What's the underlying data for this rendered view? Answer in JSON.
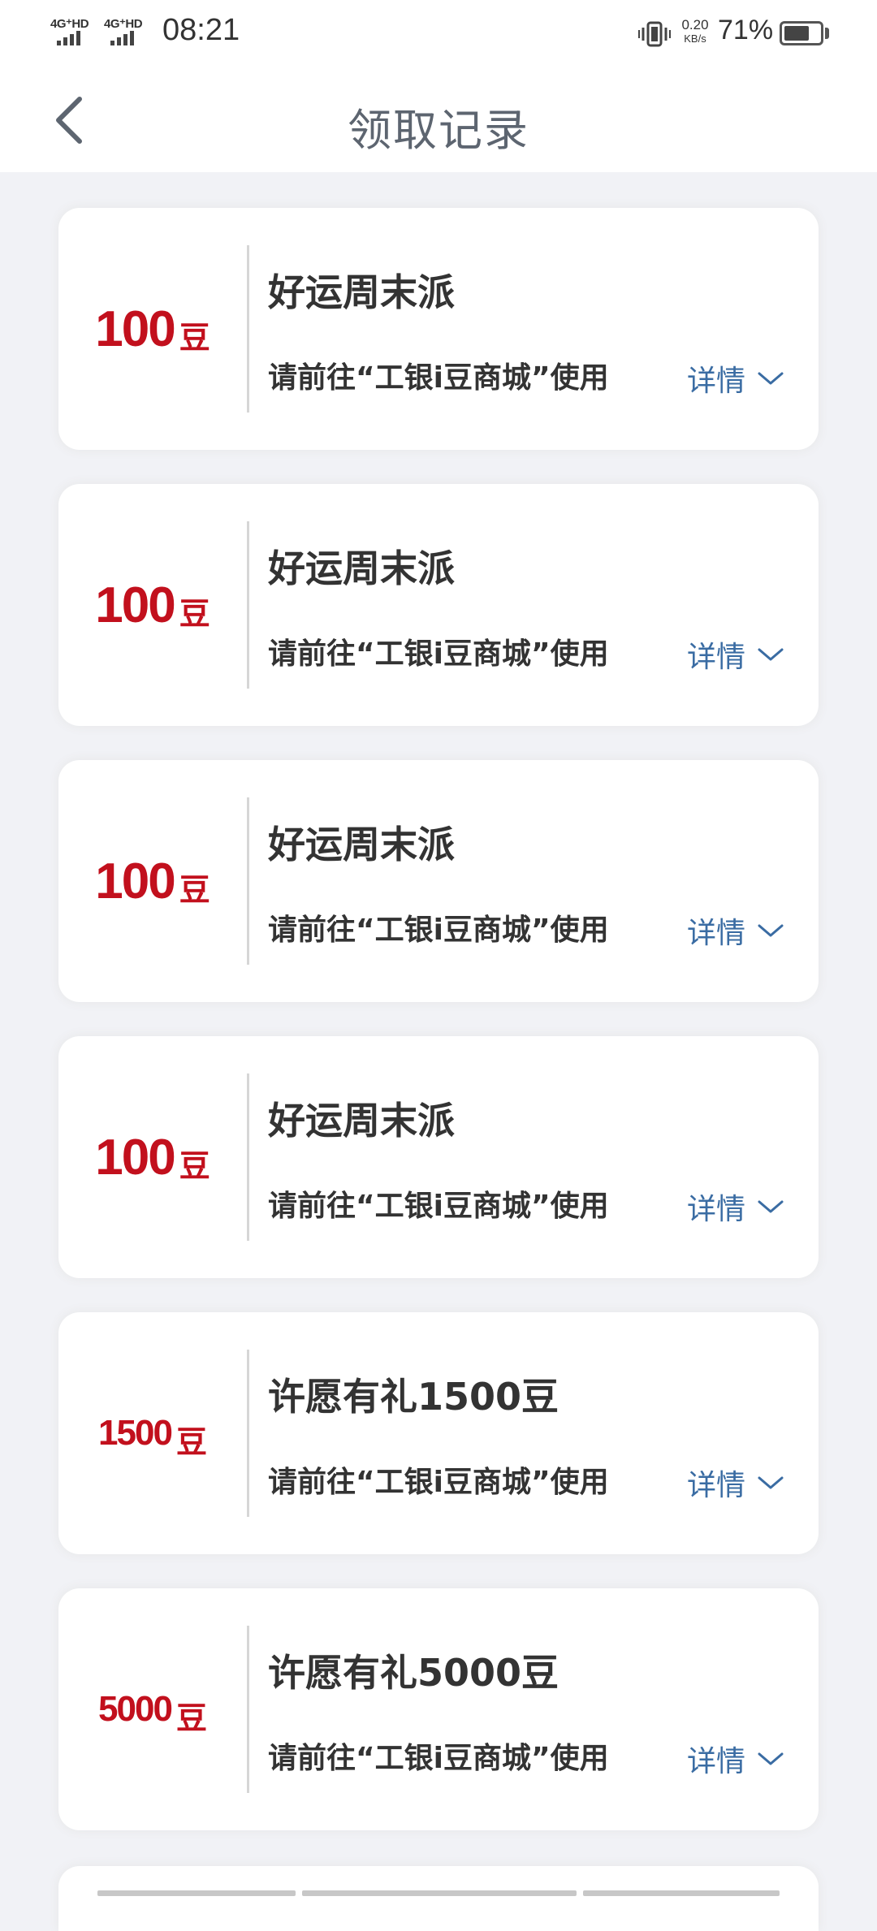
{
  "status_bar": {
    "sim1_label": "4G⁺HD",
    "sim2_label": "4G⁺HD",
    "time": "08:21",
    "net_speed_value": "0.20",
    "net_speed_unit": "KB/s",
    "battery_percent": "71%",
    "battery_level": 0.71
  },
  "nav": {
    "title": "领取记录",
    "back_icon": "chevron-left-icon"
  },
  "records": [
    {
      "amount": "100",
      "unit": "豆",
      "title": "好运周末派",
      "desc": "请前往“工银i豆商城”使用",
      "detail_label": "详情"
    },
    {
      "amount": "100",
      "unit": "豆",
      "title": "好运周末派",
      "desc": "请前往“工银i豆商城”使用",
      "detail_label": "详情"
    },
    {
      "amount": "100",
      "unit": "豆",
      "title": "好运周末派",
      "desc": "请前往“工银i豆商城”使用",
      "detail_label": "详情"
    },
    {
      "amount": "100",
      "unit": "豆",
      "title": "好运周末派",
      "desc": "请前往“工银i豆商城”使用",
      "detail_label": "详情"
    },
    {
      "amount": "1500",
      "unit": "豆",
      "title": "许愿有礼1500豆",
      "desc": "请前往“工银i豆商城”使用",
      "detail_label": "详情"
    },
    {
      "amount": "5000",
      "unit": "豆",
      "title": "许愿有礼5000豆",
      "desc": "请前往“工银i豆商城”使用",
      "detail_label": "详情"
    }
  ],
  "colors": {
    "amount": "#c2101d",
    "detail_link": "#3a6ca3",
    "page_background": "#f1f2f6"
  }
}
